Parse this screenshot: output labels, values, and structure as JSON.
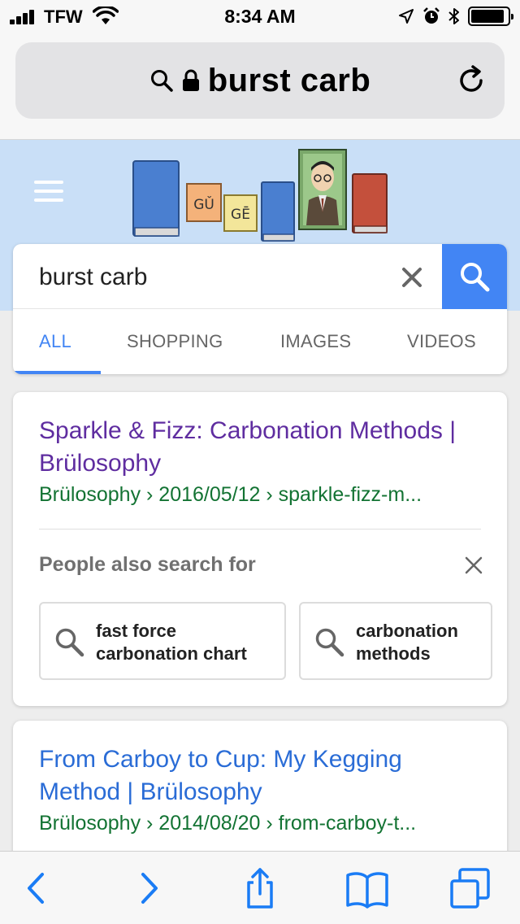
{
  "status_bar": {
    "carrier": "TFW",
    "time": "8:34 AM",
    "battery_level": 0.9
  },
  "browser": {
    "url_text": "burst carb",
    "reload_icon": "reload-icon",
    "lock_icon": "lock-icon"
  },
  "google": {
    "doodle_text_1": "GǓ",
    "doodle_text_2": "GĒ",
    "search_query": "burst carb",
    "tabs": [
      {
        "label": "ALL",
        "active": true
      },
      {
        "label": "SHOPPING",
        "active": false
      },
      {
        "label": "IMAGES",
        "active": false
      },
      {
        "label": "VIDEOS",
        "active": false
      }
    ],
    "accent_color": "#4285f4"
  },
  "results": [
    {
      "title": "Sparkle & Fizz: Carbonation Methods | Brülosophy",
      "url": "Brülosophy › 2016/05/12 › sparkle-fizz-m...",
      "visited": true
    },
    {
      "title": "From Carboy to Cup: My Kegging Method | Brülosophy",
      "url": "Brülosophy › 2014/08/20 › from-carboy-t...",
      "visited": false
    }
  ],
  "people_also_search": {
    "heading": "People also search for",
    "chips": [
      {
        "line1": "fast force",
        "line2": "carbonation chart"
      },
      {
        "line1": "carbonation",
        "line2": "methods"
      }
    ]
  },
  "toolbar": {
    "icons": [
      "back-icon",
      "forward-icon",
      "share-icon",
      "bookmarks-icon",
      "tabs-icon"
    ],
    "tint_color": "#1a7cf5"
  }
}
